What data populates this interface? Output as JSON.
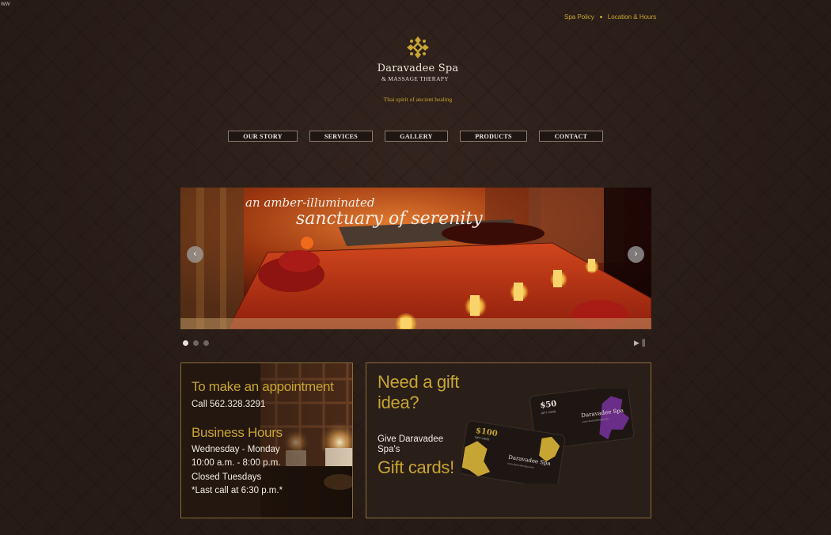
{
  "corner_text": "ww",
  "top_links": [
    "Spa Policy",
    "Location & Hours"
  ],
  "logo": {
    "name": "Daravadee Spa",
    "subtitle": "& MASSAGE THERAPY",
    "tagline": "Thai spirit of ancient healing"
  },
  "nav": [
    "OUR STORY",
    "SERVICES",
    "GALLERY",
    "PRODUCTS",
    "CONTACT"
  ],
  "slider": {
    "caption_line1": "an amber-illuminated",
    "caption_line2": "sanctuary of serenity",
    "prev_icon": "‹",
    "next_icon": "›",
    "slide_count": 3,
    "active_slide": 1,
    "play_icon": "▶",
    "pause_icon": "||"
  },
  "appointment": {
    "heading": "To make an appointment",
    "phone": "Call 562.328.3291",
    "hours_heading": "Business Hours",
    "hours_lines": [
      "Wednesday - Monday",
      "10:00 a.m. - 8:00 p.m.",
      "Closed Tuesdays",
      "*Last call at 6:30 p.m.*"
    ]
  },
  "gift": {
    "question_line1": "Need a gift",
    "question_line2": "idea?",
    "give_line1": "Give Daravadee",
    "give_line2": "Spa's",
    "cta": "Gift cards!",
    "card_front": {
      "amount": "$100",
      "label": "GIFT CARD",
      "brand": "Daravadee Spa",
      "url": "www.daravadeespa.com"
    },
    "card_back": {
      "amount": "$50",
      "label": "GIFT CARD",
      "brand": "Daravadee Spa",
      "url": "www.daravadeespa.com"
    }
  },
  "colors": {
    "background": "#2b1e19",
    "gold": "#c7a534",
    "nav_border": "#8d7a68",
    "box_border": "#8a6a3b",
    "card_purple": "#6a2d88"
  }
}
